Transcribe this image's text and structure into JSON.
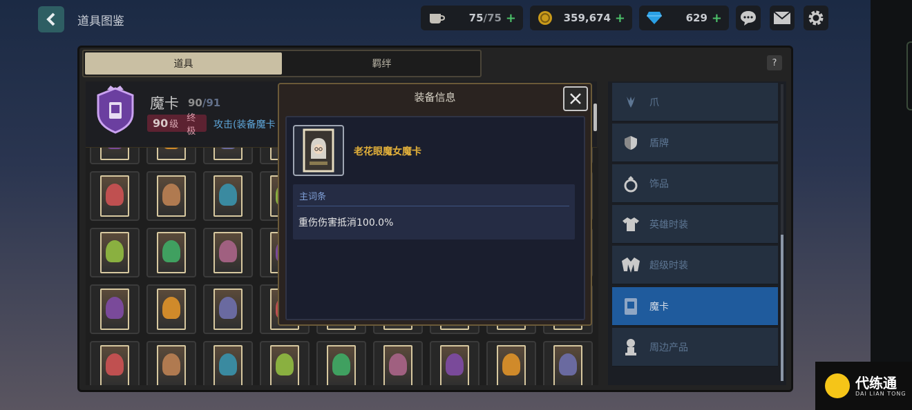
{
  "header": {
    "title": "道具图鉴",
    "resources": [
      {
        "icon": "coffee-cup-icon",
        "value": "75",
        "max": "/75"
      },
      {
        "icon": "gold-coin-icon",
        "value": "359,674"
      },
      {
        "icon": "blue-diamond-icon",
        "value": "629"
      }
    ],
    "plus": "+"
  },
  "tabs": [
    "道具",
    "羁绊"
  ],
  "help": "?",
  "card_info": {
    "name": "魔卡",
    "count": "90",
    "count_max": "/91",
    "level": "90",
    "level_unit": "级",
    "tier": "终极",
    "attack_text": "攻击(装备魔卡"
  },
  "sidebar": {
    "items": [
      {
        "label": "爪",
        "icon": "claw-icon"
      },
      {
        "label": "盾牌",
        "icon": "shield-icon"
      },
      {
        "label": "饰品",
        "icon": "ring-icon"
      },
      {
        "label": "英雄时装",
        "icon": "shirt-icon"
      },
      {
        "label": "超级时装",
        "icon": "jacket-icon"
      },
      {
        "label": "魔卡",
        "icon": "card-icon",
        "active": true
      },
      {
        "label": "周边产品",
        "icon": "figure-icon"
      }
    ]
  },
  "dialog": {
    "title": "装备信息",
    "item_name": "老花眼魔女魔卡",
    "affix_title": "主词条",
    "affix_text": "重伤伤害抵消100.0%"
  },
  "watermark": {
    "cn": "代练通",
    "en": "DAI LIAN TONG"
  },
  "colors": {
    "accent_blue": "#1f5b9d",
    "gold_text": "#e2b03a",
    "plus_green": "#4cc16a",
    "affix_blue": "#7f9fd6"
  }
}
